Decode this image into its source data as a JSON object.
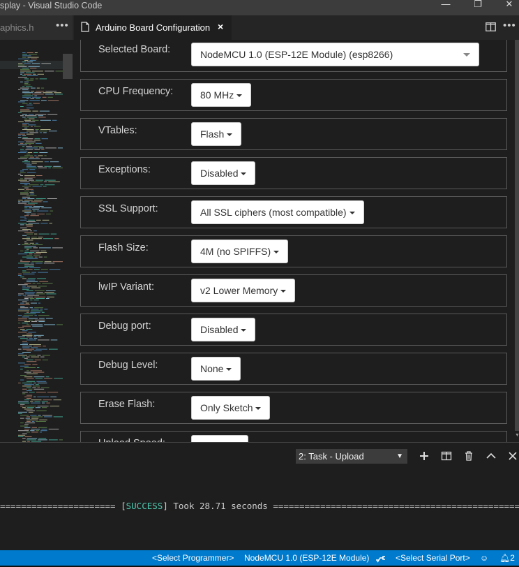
{
  "window": {
    "title": "splay - Visual Studio Code",
    "minimize": "—",
    "restore": "❐",
    "close": "✕"
  },
  "tabs": {
    "inactive_label": "aphics.h",
    "inactive_more": "•••",
    "active_label": "Arduino Board Configuration",
    "active_close": "×",
    "more": "•••"
  },
  "config": {
    "rows": [
      {
        "label": "Selected Board:",
        "value": "NodeMCU 1.0 (ESP-12E Module) (esp8266)"
      },
      {
        "label": "CPU Frequency:",
        "value": "80 MHz"
      },
      {
        "label": "VTables:",
        "value": "Flash"
      },
      {
        "label": "Exceptions:",
        "value": "Disabled"
      },
      {
        "label": "SSL Support:",
        "value": "All SSL ciphers (most compatible)"
      },
      {
        "label": "Flash Size:",
        "value": "4M (no SPIFFS)"
      },
      {
        "label": "lwIP Variant:",
        "value": "v2 Lower Memory"
      },
      {
        "label": "Debug port:",
        "value": "Disabled"
      },
      {
        "label": "Debug Level:",
        "value": "None"
      },
      {
        "label": "Erase Flash:",
        "value": "Only Sketch"
      },
      {
        "label": "Upload Speed:",
        "value": ""
      }
    ]
  },
  "panel": {
    "task": "2: Task - Upload",
    "output_left": "====================== [",
    "output_status": "SUCCESS",
    "output_right": "] Took 28.71 seconds ================================================="
  },
  "statusbar": {
    "programmer": "<Select Programmer>",
    "board": "NodeMCU 1.0 (ESP-12E Module)",
    "serial_port": "<Select Serial Port>",
    "notifications": "2"
  },
  "colors": {
    "accent": "#007acc",
    "success": "#4ec9b0",
    "editor_bg": "#1e1e1e"
  }
}
